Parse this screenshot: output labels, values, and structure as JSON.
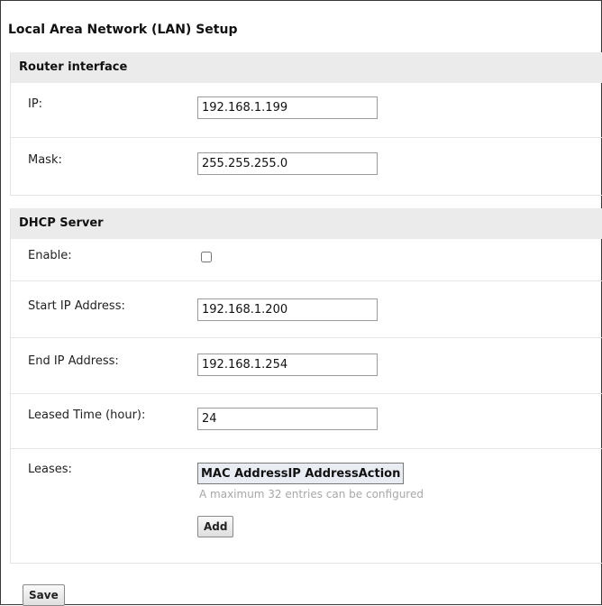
{
  "page": {
    "title": "Local Area Network (LAN) Setup"
  },
  "router_interface": {
    "heading": "Router interface",
    "ip_label": "IP:",
    "ip_value": "192.168.1.199",
    "mask_label": "Mask:",
    "mask_value": "255.255.255.0"
  },
  "dhcp_server": {
    "heading": "DHCP Server",
    "enable_label": "Enable:",
    "enable_checked": false,
    "start_ip_label": "Start IP Address:",
    "start_ip_value": "192.168.1.200",
    "end_ip_label": "End IP Address:",
    "end_ip_value": "192.168.1.254",
    "lease_time_label": "Leased Time (hour):",
    "lease_time_value": "24",
    "leases_label": "Leases:",
    "leases_columns": [
      "MAC Address",
      "IP Address",
      "Action"
    ],
    "leases_hint": "A maximum 32 entries can be configured",
    "add_label": "Add"
  },
  "save_label": "Save"
}
